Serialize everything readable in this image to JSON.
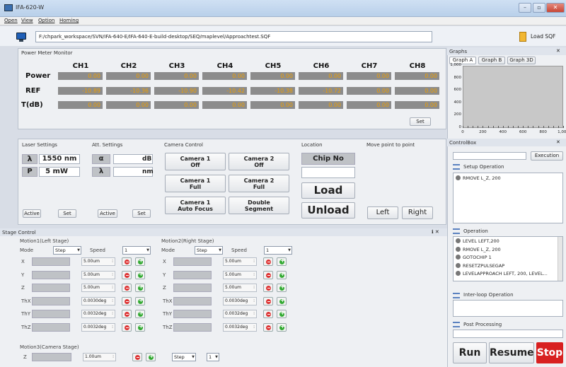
{
  "window": {
    "title": "IFA-620-W",
    "min": "–",
    "max": "▫",
    "close": "✕"
  },
  "menu": [
    "Open",
    "View",
    "Option",
    "Homing"
  ],
  "path": {
    "value": "F:/chpark_workspace/SVN/IFA-640-E/IFA-640-E-build-desktop/SEQ/maplevel/Approachtest.SQF",
    "load_label": "Load SQF"
  },
  "power_meter": {
    "title": "Power Meter Monitor",
    "channels": [
      "CH1",
      "CH2",
      "CH3",
      "CH4",
      "CH5",
      "CH6",
      "CH7",
      "CH8"
    ],
    "rows": [
      {
        "label": "Power",
        "values": [
          "0.00",
          "0.00",
          "0.00",
          "0.00",
          "0.00",
          "0.00",
          "0.00",
          "0.00"
        ]
      },
      {
        "label": "REF",
        "values": [
          "-10.89",
          "-10.36",
          "-10.90",
          "-10.42",
          "-10.38",
          "-10.72",
          "0.00",
          "0.00"
        ]
      },
      {
        "label": "T(dB)",
        "values": [
          "0.00",
          "0.00",
          "0.00",
          "0.00",
          "0.00",
          "0.00",
          "0.00",
          "0.00"
        ]
      }
    ],
    "set_label": "Set"
  },
  "laser": {
    "title": "Laser Settings",
    "lambda_sym": "λ",
    "lambda_val": "1550 nm",
    "p_sym": "P",
    "p_val": "5 mW",
    "active": "Active",
    "set": "Set"
  },
  "att": {
    "title": "Att. Settings",
    "alpha_sym": "α",
    "alpha_unit": "dB",
    "lambda_sym": "λ",
    "lambda_unit": "nm",
    "active": "Active",
    "set": "Set"
  },
  "camera": {
    "title": "Camera Control",
    "buttons": [
      [
        "Camera 1",
        "Off"
      ],
      [
        "Camera 2",
        "Off"
      ],
      [
        "Camera 1",
        "Full"
      ],
      [
        "Camera 2",
        "Full"
      ],
      [
        "Camera 1",
        "Auto Focus"
      ],
      [
        "Double",
        "Segment"
      ]
    ]
  },
  "location": {
    "title": "Location",
    "chip": "Chip No",
    "load": "Load",
    "unload": "Unload"
  },
  "move": {
    "title": "Move point to point",
    "left": "Left",
    "right": "Right"
  },
  "graphs": {
    "title": "Graphs",
    "tabs": [
      "Graph A",
      "Graph B",
      "Graph 3D"
    ],
    "yticks": [
      "1,000",
      "800",
      "600",
      "400",
      "200",
      "0"
    ],
    "xticks": [
      "0",
      "200",
      "400",
      "600",
      "800",
      "1,000"
    ]
  },
  "controlbox": {
    "title": "ControlBox",
    "execution": "Execution",
    "setup_title": "Setup Operation",
    "setup_items": [
      "RMOVE L_Z, 200"
    ],
    "op_title": "Operation",
    "op_items": [
      "LEVEL LEFT,200",
      "RMOVE L_Z, 200",
      "GOTOCHIP 1",
      "RESETZPULSEGAP",
      "LEVELAPPROACH LEFT, 200, LEVEL..."
    ],
    "interloop_title": "Inter-loop Operation",
    "post_title": "Post Processing",
    "run": "Run",
    "resume": "Resume",
    "stop": "Stop"
  },
  "stage": {
    "title": "Stage Control",
    "motion1": {
      "title": "Motion1(Left Stage)",
      "mode_label": "Mode",
      "mode": "Step",
      "speed_label": "Speed",
      "speed": "1",
      "axes": [
        {
          "name": "X",
          "step": "5.00um"
        },
        {
          "name": "Y",
          "step": "5.00um"
        },
        {
          "name": "Z",
          "step": "5.00um"
        },
        {
          "name": "ThX",
          "step": "0.0030deg"
        },
        {
          "name": "ThY",
          "step": "0.0032deg"
        },
        {
          "name": "ThZ",
          "step": "0.0032deg"
        }
      ]
    },
    "motion2": {
      "title": "Motion2(Right Stage)",
      "mode_label": "Mode",
      "mode": "Step",
      "speed_label": "Speed",
      "speed": "1",
      "axes": [
        {
          "name": "X",
          "step": "5.00um"
        },
        {
          "name": "Y",
          "step": "5.00um"
        },
        {
          "name": "Z",
          "step": "5.00um"
        },
        {
          "name": "ThX",
          "step": "0.0030deg"
        },
        {
          "name": "ThY",
          "step": "0.0032deg"
        },
        {
          "name": "ThZ",
          "step": "0.0032deg"
        }
      ]
    },
    "motion3": {
      "title": "Motion3(Camera Stage)",
      "axis": "Z",
      "step": "1.00um",
      "mode": "Step",
      "speed": "1"
    }
  }
}
